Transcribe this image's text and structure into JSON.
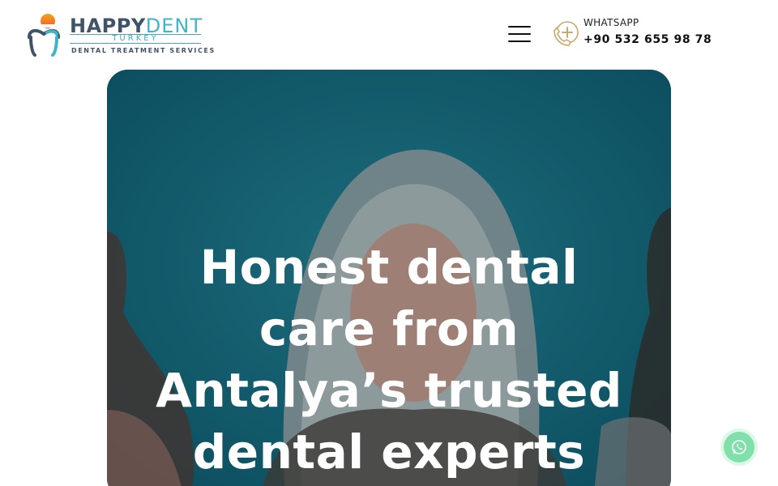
{
  "brand": {
    "name_happy": "HAPPY",
    "name_dent": "DENT",
    "country": "TURKEY",
    "tagline": "DENTAL TREATMENT SERVICES"
  },
  "header": {
    "menu_icon": "hamburger-menu-icon",
    "contact_label": "WHATSAPP",
    "contact_phone": "+90 532 655 98 78",
    "contact_icon": "phone-plus-icon"
  },
  "hero": {
    "title": "Honest dental care from Antalya’s trusted dental experts",
    "overlay_color": "#10596a"
  },
  "floating": {
    "icon": "whatsapp-icon",
    "color": "#7fe0a9"
  }
}
